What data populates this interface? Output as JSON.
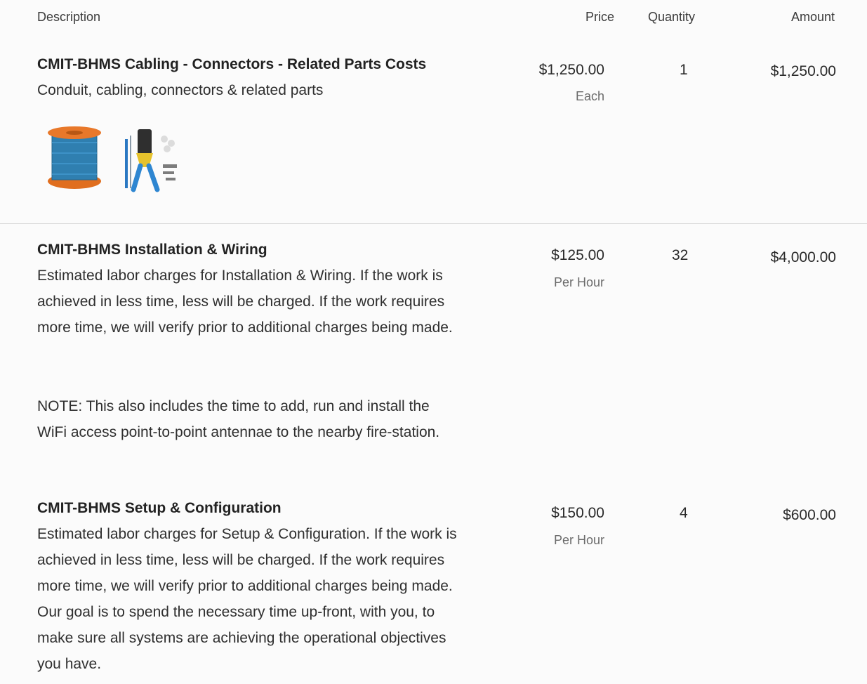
{
  "headers": {
    "description": "Description",
    "price": "Price",
    "quantity": "Quantity",
    "amount": "Amount"
  },
  "items": [
    {
      "title": "CMIT-BHMS Cabling - Connectors - Related Parts Costs",
      "description": "Conduit, cabling, connectors & related parts",
      "price": "$1,250.00",
      "unit": "Each",
      "quantity": "1",
      "amount": "$1,250.00",
      "images": [
        "cable-spool-icon",
        "crimping-tool-icon"
      ]
    },
    {
      "title": "CMIT-BHMS Installation & Wiring",
      "description": "Estimated labor charges for Installation & Wiring. If the work is achieved in less time, less will be charged. If the work requires more time, we will verify prior to additional charges being made.",
      "note": "NOTE: This also includes the time to add, run and install the WiFi access point-to-point antennae to the nearby fire-station.",
      "price": "$125.00",
      "unit": "Per Hour",
      "quantity": "32",
      "amount": "$4,000.00"
    },
    {
      "title": "CMIT-BHMS Setup & Configuration",
      "description": "Estimated labor charges for Setup & Configuration. If the work is achieved in less time, less will be charged. If the work requires more time, we will verify prior to additional charges being made. Our goal is to spend the necessary time up-front, with you, to make sure all systems are achieving the operational objectives you have.",
      "price": "$150.00",
      "unit": "Per Hour",
      "quantity": "4",
      "amount": "$600.00"
    }
  ]
}
